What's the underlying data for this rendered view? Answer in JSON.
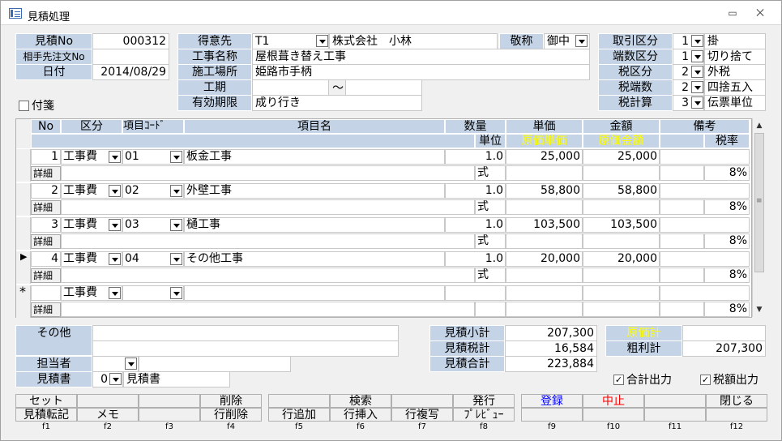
{
  "window": {
    "title": "見積処理",
    "minimize": "▭",
    "close": "⨉"
  },
  "header": {
    "estimate_no_label": "見積No",
    "estimate_no": "000312",
    "order_no_label": "相手先注文No",
    "order_no": "",
    "date_label": "日付",
    "date": "2014/08/29",
    "sticky_label": "付箋",
    "customer_label": "得意先",
    "customer_code": "T1",
    "customer_name": "株式会社　小林",
    "honorific_label": "敬称",
    "honorific": "御中",
    "project_label": "工事名称",
    "project": "屋根葺き替え工事",
    "site_label": "施工場所",
    "site": "姫路市手柄",
    "period_label": "工期",
    "period_sep": "〜",
    "period_from": "",
    "period_to": "",
    "validity_label": "有効期限",
    "validity": "成り行き",
    "trade_label": "取引区分",
    "trade_code": "1",
    "trade": "掛",
    "rounding_label": "端数区分",
    "rounding_code": "1",
    "rounding": "切り捨て",
    "tax_label": "税区分",
    "tax_code": "2",
    "tax": "外税",
    "tax_round_label": "税端数",
    "tax_round_code": "2",
    "tax_round": "四捨五入",
    "tax_calc_label": "税計算",
    "tax_calc_code": "3",
    "tax_calc": "伝票単位"
  },
  "grid": {
    "headers": {
      "no": "No",
      "category": "区分",
      "item_code": "項目ｺｰﾄﾞ",
      "item_name": "項目名",
      "qty": "数量",
      "unit": "単位",
      "price": "単価",
      "cost_price": "原価単価",
      "amount": "金額",
      "cost_amount": "原価金額",
      "note": "備考",
      "tax_rate": "税率"
    },
    "detail_label": "詳細",
    "rows": [
      {
        "no": "1",
        "category": "工事費",
        "code": "01",
        "name": "板金工事",
        "qty": "1.0",
        "unit": "式",
        "price": "25,000",
        "amount": "25,000",
        "tax_rate": "8%"
      },
      {
        "no": "2",
        "category": "工事費",
        "code": "02",
        "name": "外壁工事",
        "qty": "1.0",
        "unit": "式",
        "price": "58,800",
        "amount": "58,800",
        "tax_rate": "8%"
      },
      {
        "no": "3",
        "category": "工事費",
        "code": "03",
        "name": "樋工事",
        "qty": "1.0",
        "unit": "式",
        "price": "103,500",
        "amount": "103,500",
        "tax_rate": "8%"
      },
      {
        "no": "4",
        "category": "工事費",
        "code": "04",
        "name": "その他工事",
        "qty": "1.0",
        "unit": "式",
        "price": "20,000",
        "amount": "20,000",
        "tax_rate": "8%"
      }
    ],
    "new_row": {
      "marker": "*",
      "category": "工事費",
      "tax_rate": "8%"
    },
    "current_marker": "▶"
  },
  "footer": {
    "other_label": "その他",
    "other1": "",
    "other2": "",
    "staff_label": "担当者",
    "staff": "",
    "doc_label": "見積書",
    "doc_code": "0",
    "doc_name": "見積書",
    "subtotal_label": "見積小計",
    "subtotal": "207,300",
    "tax_label": "見積税計",
    "tax": "16,584",
    "total_label": "見積合計",
    "total": "223,884",
    "cost_total_label": "原価計",
    "cost_total": "",
    "gross_label": "粗利計",
    "gross": "207,300",
    "sum_output_label": "合計出力",
    "tax_output_label": "税額出力"
  },
  "fkeys": {
    "f1_top": "セット",
    "f1_bottom": "見積転記",
    "f2_bottom": "メモ",
    "f4_top": "削除",
    "f4_bottom": "行削除",
    "f5_bottom": "行追加",
    "f6_top": "検索",
    "f6_bottom": "行挿入",
    "f7_bottom": "行複写",
    "f8_top": "発行",
    "f8_bottom": "ﾌﾟﾚﾋﾞｭｰ",
    "f9_top": "登録",
    "f10_top": "中止",
    "f12_top": "閉じる",
    "labels": [
      "f1",
      "f2",
      "f3",
      "f4",
      "f5",
      "f6",
      "f7",
      "f8",
      "f9",
      "f10",
      "f11",
      "f12"
    ],
    "register_color": "#0000ff",
    "cancel_color": "#ff0000"
  }
}
